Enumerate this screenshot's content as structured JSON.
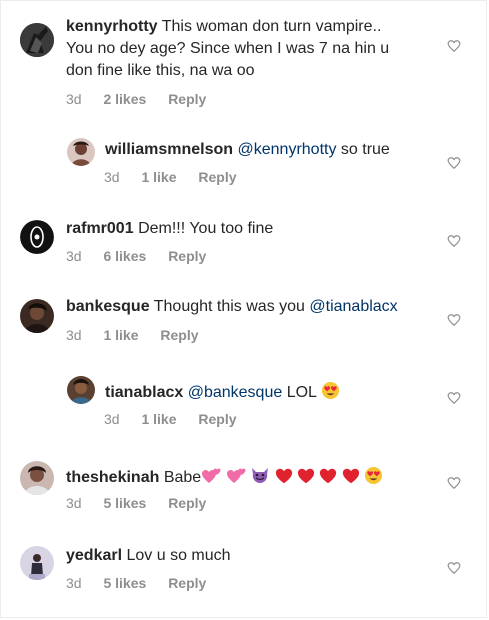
{
  "comments": [
    {
      "user": "kennyrhotty",
      "lines": [
        "This woman don turn vampire..",
        "You no dey age? Since when I was 7 na hin u",
        "don fine like this, na wa oo"
      ],
      "time": "3d",
      "likes": "2 likes",
      "reply": "Reply"
    },
    {
      "user": "williamsmnelson",
      "mention": "@kennyrhotty",
      "text": " so true",
      "time": "3d",
      "likes": "1 like",
      "reply": "Reply"
    },
    {
      "user": "rafmr001",
      "text": "Dem!!! You too fine",
      "time": "3d",
      "likes": "6 likes",
      "reply": "Reply"
    },
    {
      "user": "bankesque",
      "text": "Thought this was you ",
      "mention": "@tianablacx",
      "time": "3d",
      "likes": "1 like",
      "reply": "Reply"
    },
    {
      "user": "tianablacx",
      "mention": "@bankesque",
      "text": " LOL",
      "time": "3d",
      "likes": "1 like",
      "reply": "Reply"
    },
    {
      "user": "theshekinah",
      "text": "Babe",
      "time": "3d",
      "likes": "5 likes",
      "reply": "Reply"
    },
    {
      "user": "yedkarl",
      "text": "Lov u so much",
      "time": "3d",
      "likes": "5 likes",
      "reply": "Reply"
    }
  ],
  "colors": {
    "text": "#262626",
    "meta": "#8e8e8e",
    "mention": "#003569",
    "heart_outline": "#8e8e8e"
  },
  "icons": {
    "like": "heart-outline-icon"
  }
}
